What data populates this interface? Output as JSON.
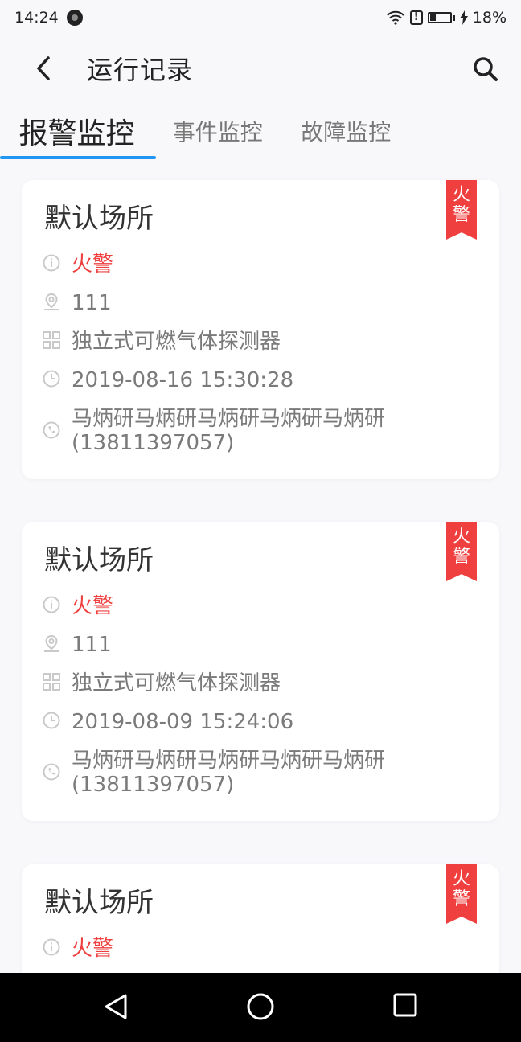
{
  "status": {
    "time": "14:24",
    "battery": "18%"
  },
  "header": {
    "title": "运行记录"
  },
  "tabs": [
    {
      "label": "报警监控"
    },
    {
      "label": "事件监控"
    },
    {
      "label": "故障监控"
    }
  ],
  "records": [
    {
      "place": "默认场所",
      "badge": "火警",
      "type": "火警",
      "location": "111",
      "device": "独立式可燃气体探测器",
      "time": "2019-08-16 15:30:28",
      "contact": "马炳研马炳研马炳研马炳研马炳研",
      "phone": "(13811397057)"
    },
    {
      "place": "默认场所",
      "badge": "火警",
      "type": "火警",
      "location": "111",
      "device": "独立式可燃气体探测器",
      "time": "2019-08-09 15:24:06",
      "contact": "马炳研马炳研马炳研马炳研马炳研",
      "phone": "(13811397057)"
    },
    {
      "place": "默认场所",
      "badge": "火警",
      "type": "火警"
    }
  ],
  "colors": {
    "accent": "#2196f3",
    "alarm": "#ef3f3f"
  }
}
